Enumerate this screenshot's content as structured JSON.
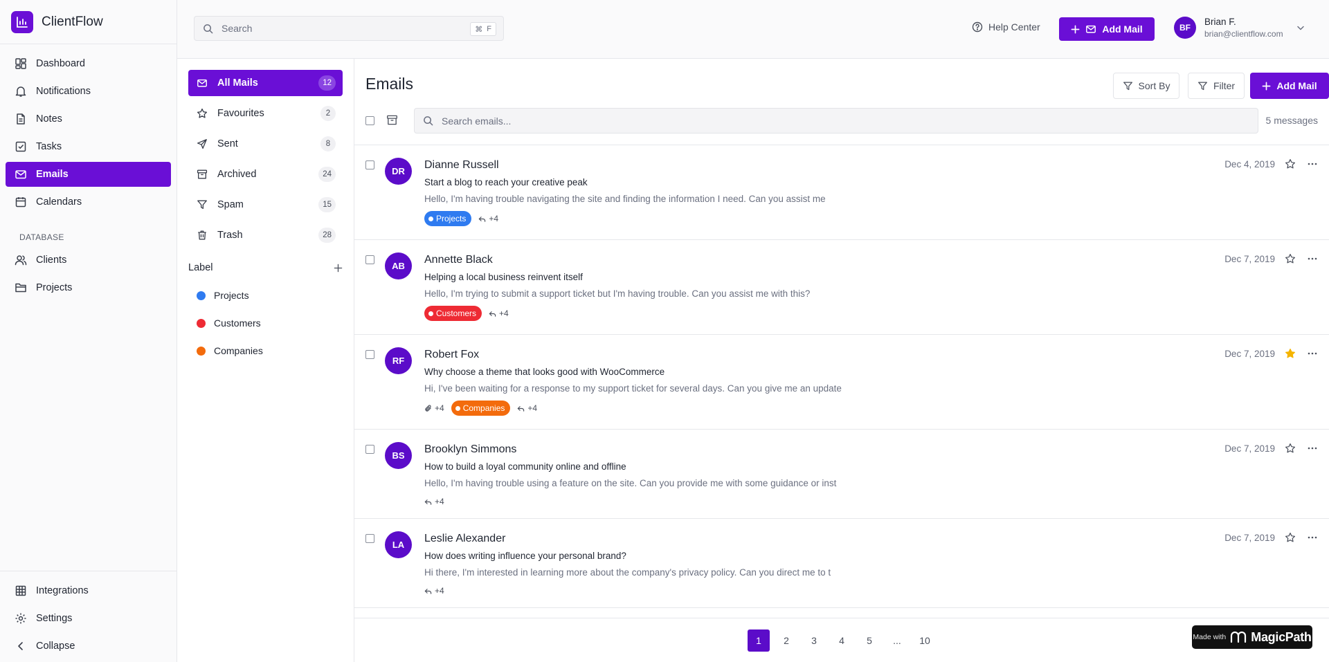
{
  "app": {
    "name": "ClientFlow"
  },
  "sidebar": {
    "items": [
      {
        "label": "Dashboard",
        "icon": "dashboard-icon"
      },
      {
        "label": "Notifications",
        "icon": "bell-icon"
      },
      {
        "label": "Notes",
        "icon": "note-icon"
      },
      {
        "label": "Tasks",
        "icon": "task-icon"
      },
      {
        "label": "Emails",
        "icon": "mail-icon",
        "active": true
      },
      {
        "label": "Calendars",
        "icon": "calendar-icon"
      }
    ],
    "section_label": "DATABASE",
    "db_items": [
      {
        "label": "Clients",
        "icon": "users-icon"
      },
      {
        "label": "Projects",
        "icon": "folder-icon"
      }
    ],
    "bottom_items": [
      {
        "label": "Integrations",
        "icon": "grid-icon"
      },
      {
        "label": "Settings",
        "icon": "gear-icon"
      },
      {
        "label": "Collapse",
        "icon": "chevron-left-icon"
      }
    ]
  },
  "header": {
    "search_placeholder": "Search",
    "shortcut_key": "⌘",
    "shortcut_letter": "F",
    "help_label": "Help Center",
    "add_mail_label": "Add Mail",
    "user": {
      "initials": "BF",
      "name": "Brian F.",
      "email": "brian@clientflow.com"
    }
  },
  "folders": {
    "items": [
      {
        "label": "All Mails",
        "count": "12",
        "icon": "mail-icon",
        "active": true
      },
      {
        "label": "Favourites",
        "count": "2",
        "icon": "star-icon"
      },
      {
        "label": "Sent",
        "count": "8",
        "icon": "send-icon"
      },
      {
        "label": "Archived",
        "count": "24",
        "icon": "archive-icon"
      },
      {
        "label": "Spam",
        "count": "15",
        "icon": "filter-icon"
      },
      {
        "label": "Trash",
        "count": "28",
        "icon": "trash-icon"
      }
    ],
    "label_heading": "Label",
    "labels": [
      {
        "label": "Projects",
        "color": "#2f7bf0"
      },
      {
        "label": "Customers",
        "color": "#ee2b34"
      },
      {
        "label": "Companies",
        "color": "#f36b0c"
      }
    ]
  },
  "main": {
    "title": "Emails",
    "sort_label": "Sort By",
    "filter_label": "Filter",
    "add_mail_label": "Add Mail",
    "search_placeholder": "Search emails...",
    "message_count": "5 messages",
    "emails": [
      {
        "initials": "DR",
        "sender": "Dianne Russell",
        "subject": "Start a blog to reach your creative peak",
        "preview": "Hello, I'm having trouble navigating the site and finding the information I need. Can you assist me",
        "date": "Dec 4, 2019",
        "starred": false,
        "attachments": "",
        "tag": {
          "label": "Projects",
          "color": "#2f7bf0"
        },
        "replies": "+4"
      },
      {
        "initials": "AB",
        "sender": "Annette Black",
        "subject": "Helping a local business reinvent itself",
        "preview": "Hello, I'm trying to submit a support ticket but I'm having trouble. Can you assist me with this?",
        "date": "Dec 7, 2019",
        "starred": false,
        "attachments": "",
        "tag": {
          "label": "Customers",
          "color": "#ee2b34"
        },
        "replies": "+4"
      },
      {
        "initials": "RF",
        "sender": "Robert Fox",
        "subject": "Why choose a theme that looks good with WooCommerce",
        "preview": "Hi, I've been waiting for a response to my support ticket for several days. Can you give me an update",
        "date": "Dec 7, 2019",
        "starred": true,
        "attachments": "+4",
        "tag": {
          "label": "Companies",
          "color": "#f36b0c"
        },
        "replies": "+4"
      },
      {
        "initials": "BS",
        "sender": "Brooklyn Simmons",
        "subject": "How to build a loyal community online and offline",
        "preview": "Hello, I'm having trouble using a feature on the site. Can you provide me with some guidance or inst",
        "date": "Dec 7, 2019",
        "starred": false,
        "attachments": "",
        "tag": null,
        "replies": "+4"
      },
      {
        "initials": "LA",
        "sender": "Leslie Alexander",
        "subject": "How does writing influence your personal brand?",
        "preview": "Hi there, I'm interested in learning more about the company's privacy policy. Can you direct me to t",
        "date": "Dec 7, 2019",
        "starred": false,
        "attachments": "",
        "tag": null,
        "replies": "+4"
      }
    ],
    "pagination": {
      "pages": [
        "1",
        "2",
        "3",
        "4",
        "5",
        "...",
        "10"
      ],
      "current": "1"
    }
  },
  "badge": {
    "prefix": "Made with",
    "brand": "MagicPath"
  },
  "colors": {
    "accent": "#6a0fd6",
    "avatar": "#5b0cc9",
    "star_active": "#f5b400"
  }
}
